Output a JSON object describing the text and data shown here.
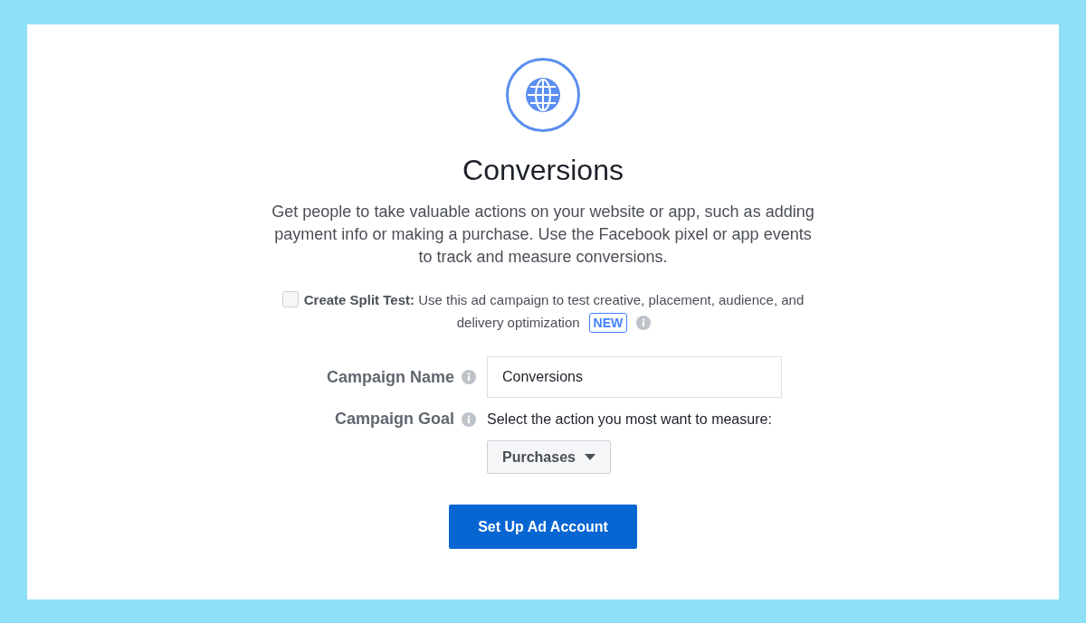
{
  "header": {
    "title": "Conversions",
    "description": "Get people to take valuable actions on your website or app, such as adding payment info or making a purchase. Use the Facebook pixel or app events to track and measure conversions."
  },
  "split_test": {
    "checked": false,
    "lines": [
      "**Create Split Test:** Use this ad campaign to test creative, placement, audience, and",
      "delivery optimization"
    ],
    "badge": "NEW"
  },
  "form": {
    "campaign_name": {
      "label": "Campaign Name",
      "value": "Conversions"
    },
    "campaign_goal": {
      "label": "Campaign Goal",
      "hint": "Select the action you most want to measure:",
      "selection": "Purchases"
    }
  },
  "button": "Set Up Ad Account"
}
